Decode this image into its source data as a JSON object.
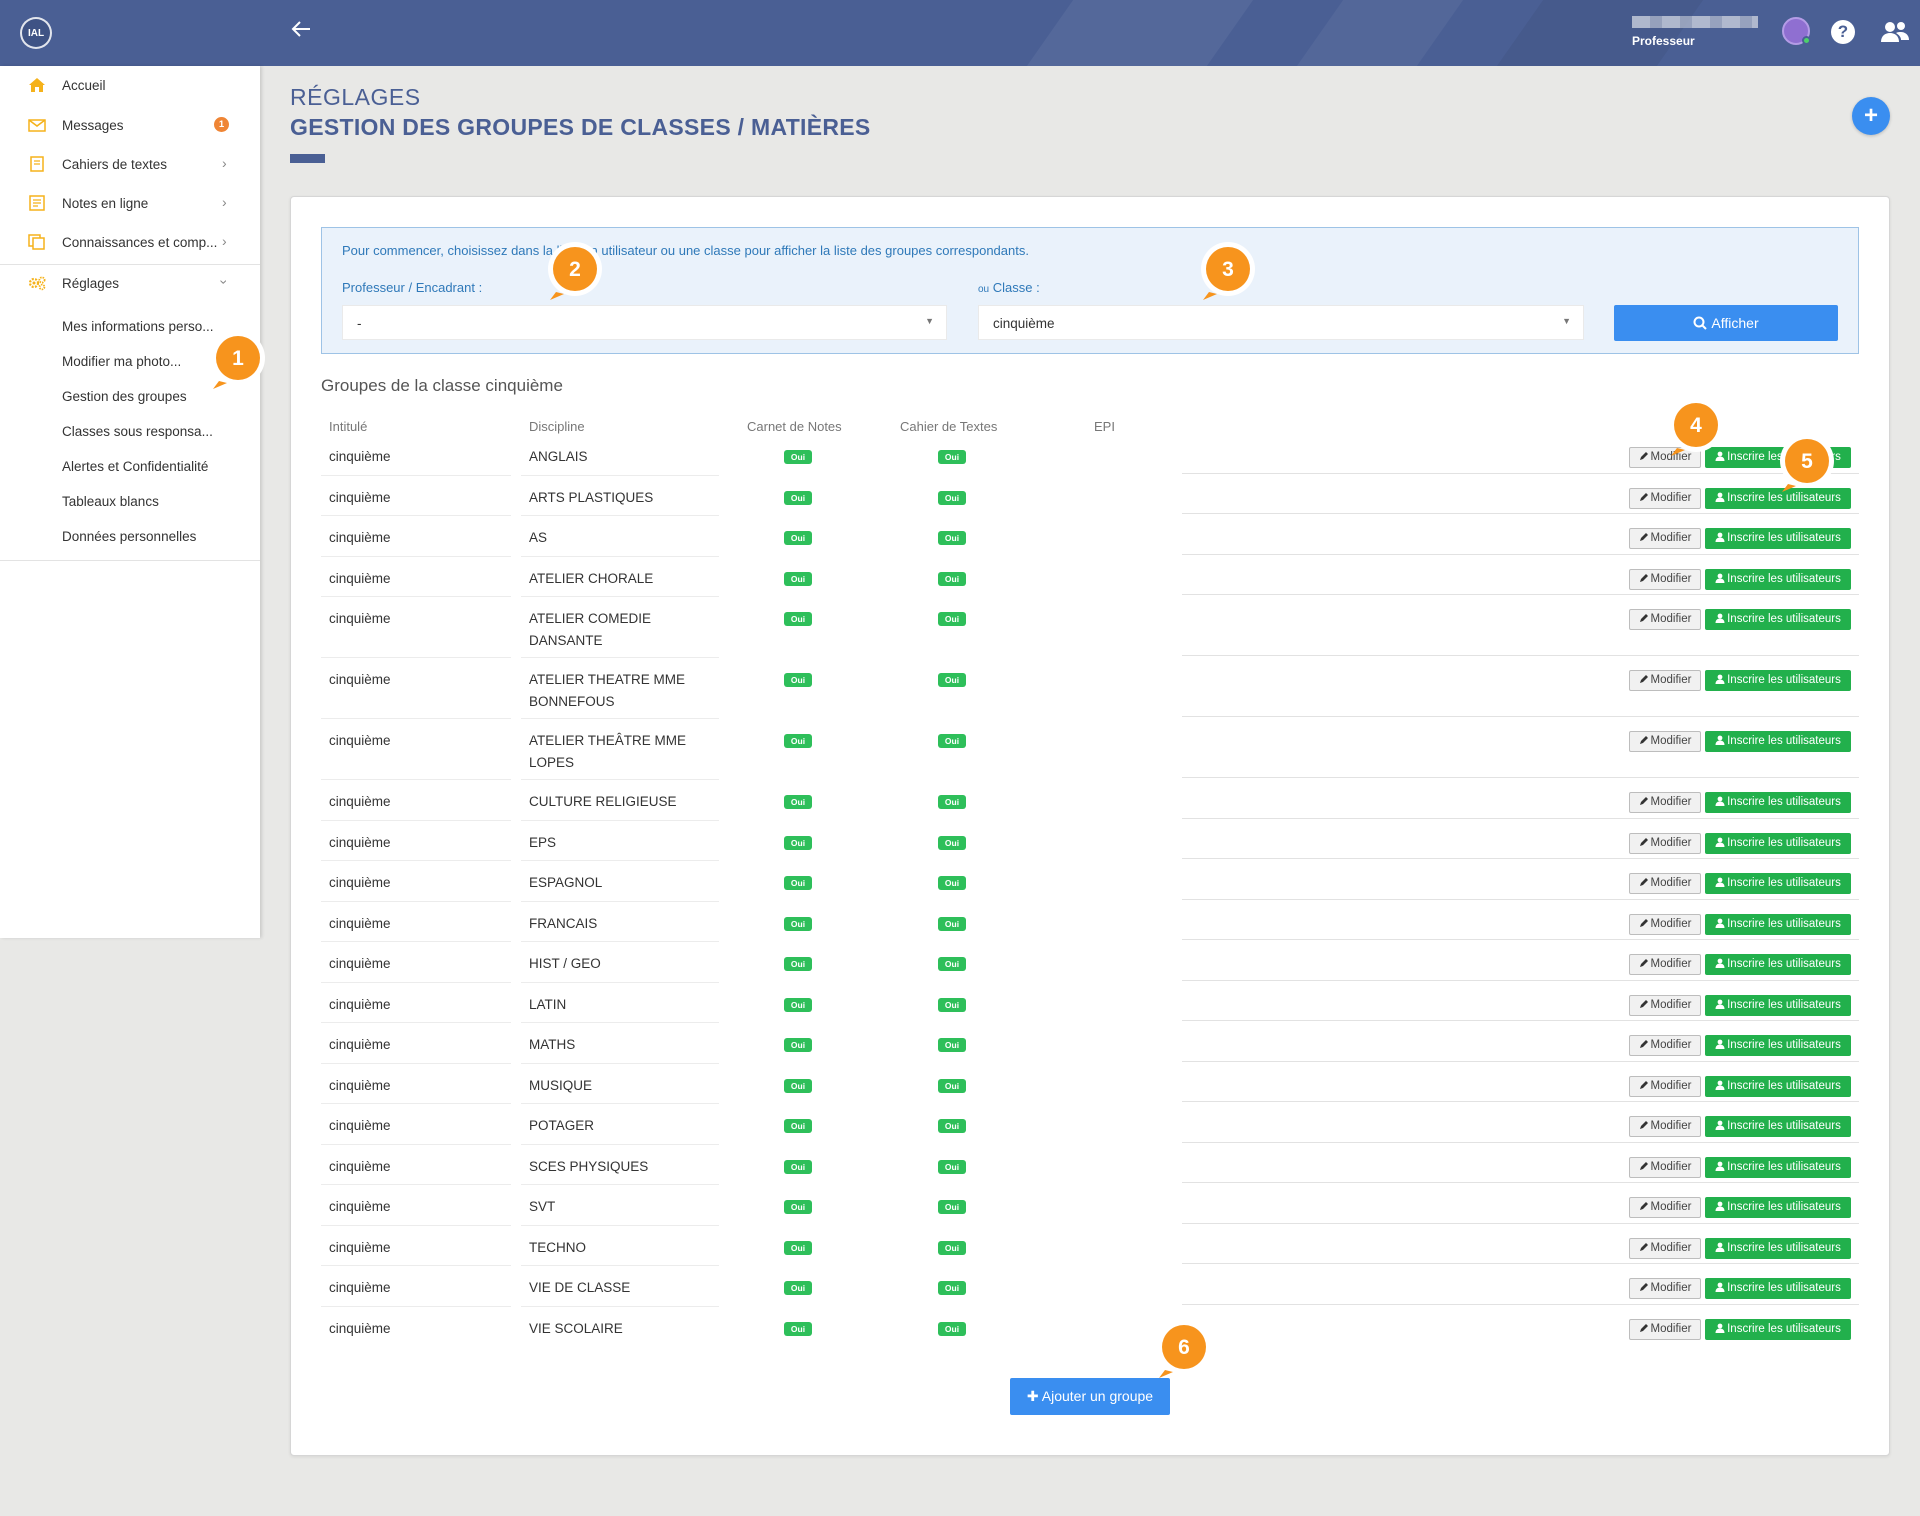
{
  "topbar": {
    "logo_text": "IAL",
    "back_icon": "arrow-left-icon",
    "user_role": "Professeur",
    "help_icon": "question-circle-icon",
    "users_icon": "users-icon",
    "color": "#4a5f94"
  },
  "sidebar": {
    "items": [
      {
        "label": "Accueil",
        "icon": "home-icon"
      },
      {
        "label": "Messages",
        "icon": "envelope-icon",
        "badge": "1"
      },
      {
        "label": "Cahiers de textes",
        "icon": "book-icon"
      },
      {
        "label": "Notes en ligne",
        "icon": "notes-icon"
      },
      {
        "label": "Connaissances et comp...",
        "icon": "copy-icon"
      },
      {
        "label": "Réglages",
        "icon": "cogs-icon"
      }
    ],
    "subitems": [
      "Mes informations perso...",
      "Modifier ma photo...",
      "Gestion des groupes",
      "Classes sous responsa...",
      "Alertes et Confidentialité",
      "Tableaux blancs",
      "Données personnelles"
    ]
  },
  "page": {
    "title_small": "RÉGLAGES",
    "title_main": "GESTION DES GROUPES DE CLASSES / MATIÈRES",
    "add_icon": "plus-icon"
  },
  "filter": {
    "intro": "Pour commencer, choisissez dans la liste un utilisateur ou une classe pour afficher la liste des groupes correspondants.",
    "prof_label": "Professeur / Encadrant :",
    "prof_value": "-",
    "ou": "ou",
    "class_label": "Classe :",
    "class_value": "cinquième",
    "afficher_label": "Afficher"
  },
  "groups": {
    "title": "Groupes de la classe cinquième",
    "headers": [
      "Intitulé",
      "Discipline",
      "Carnet de Notes",
      "Cahier de Textes",
      "EPI"
    ],
    "modifier_label": "Modifier",
    "inscrire_label": "Inscrire les utilisateurs",
    "rows": [
      {
        "intitule": "cinquième",
        "discipline": "ANGLAIS",
        "carnet": "Oui",
        "cahier": "Oui"
      },
      {
        "intitule": "cinquième",
        "discipline": "ARTS PLASTIQUES",
        "carnet": "Oui",
        "cahier": "Oui"
      },
      {
        "intitule": "cinquième",
        "discipline": "AS",
        "carnet": "Oui",
        "cahier": "Oui"
      },
      {
        "intitule": "cinquième",
        "discipline": "ATELIER CHORALE",
        "carnet": "Oui",
        "cahier": "Oui"
      },
      {
        "intitule": "cinquième",
        "discipline": "ATELIER COMEDIE DANSANTE",
        "carnet": "Oui",
        "cahier": "Oui"
      },
      {
        "intitule": "cinquième",
        "discipline": "ATELIER THEATRE MME BONNEFOUS",
        "carnet": "Oui",
        "cahier": "Oui"
      },
      {
        "intitule": "cinquième",
        "discipline": "ATELIER THEÂTRE MME LOPES",
        "carnet": "Oui",
        "cahier": "Oui"
      },
      {
        "intitule": "cinquième",
        "discipline": "CULTURE RELIGIEUSE",
        "carnet": "Oui",
        "cahier": "Oui"
      },
      {
        "intitule": "cinquième",
        "discipline": "EPS",
        "carnet": "Oui",
        "cahier": "Oui"
      },
      {
        "intitule": "cinquième",
        "discipline": "ESPAGNOL",
        "carnet": "Oui",
        "cahier": "Oui"
      },
      {
        "intitule": "cinquième",
        "discipline": "FRANCAIS",
        "carnet": "Oui",
        "cahier": "Oui"
      },
      {
        "intitule": "cinquième",
        "discipline": "HIST / GEO",
        "carnet": "Oui",
        "cahier": "Oui"
      },
      {
        "intitule": "cinquième",
        "discipline": "LATIN",
        "carnet": "Oui",
        "cahier": "Oui"
      },
      {
        "intitule": "cinquième",
        "discipline": "MATHS",
        "carnet": "Oui",
        "cahier": "Oui"
      },
      {
        "intitule": "cinquième",
        "discipline": "MUSIQUE",
        "carnet": "Oui",
        "cahier": "Oui"
      },
      {
        "intitule": "cinquième",
        "discipline": "POTAGER",
        "carnet": "Oui",
        "cahier": "Oui"
      },
      {
        "intitule": "cinquième",
        "discipline": "SCES PHYSIQUES",
        "carnet": "Oui",
        "cahier": "Oui"
      },
      {
        "intitule": "cinquième",
        "discipline": "SVT",
        "carnet": "Oui",
        "cahier": "Oui"
      },
      {
        "intitule": "cinquième",
        "discipline": "TECHNO",
        "carnet": "Oui",
        "cahier": "Oui"
      },
      {
        "intitule": "cinquième",
        "discipline": "VIE DE CLASSE",
        "carnet": "Oui",
        "cahier": "Oui"
      },
      {
        "intitule": "cinquième",
        "discipline": "VIE SCOLAIRE",
        "carnet": "Oui",
        "cahier": "Oui"
      }
    ],
    "add_label": "Ajouter un groupe"
  },
  "callouts": [
    "1",
    "2",
    "3",
    "4",
    "5",
    "6"
  ],
  "colors": {
    "accent_blue": "#3a8ef0",
    "green": "#22b04c",
    "callout_orange": "#f7941d",
    "badge_orange": "#ef8535"
  }
}
